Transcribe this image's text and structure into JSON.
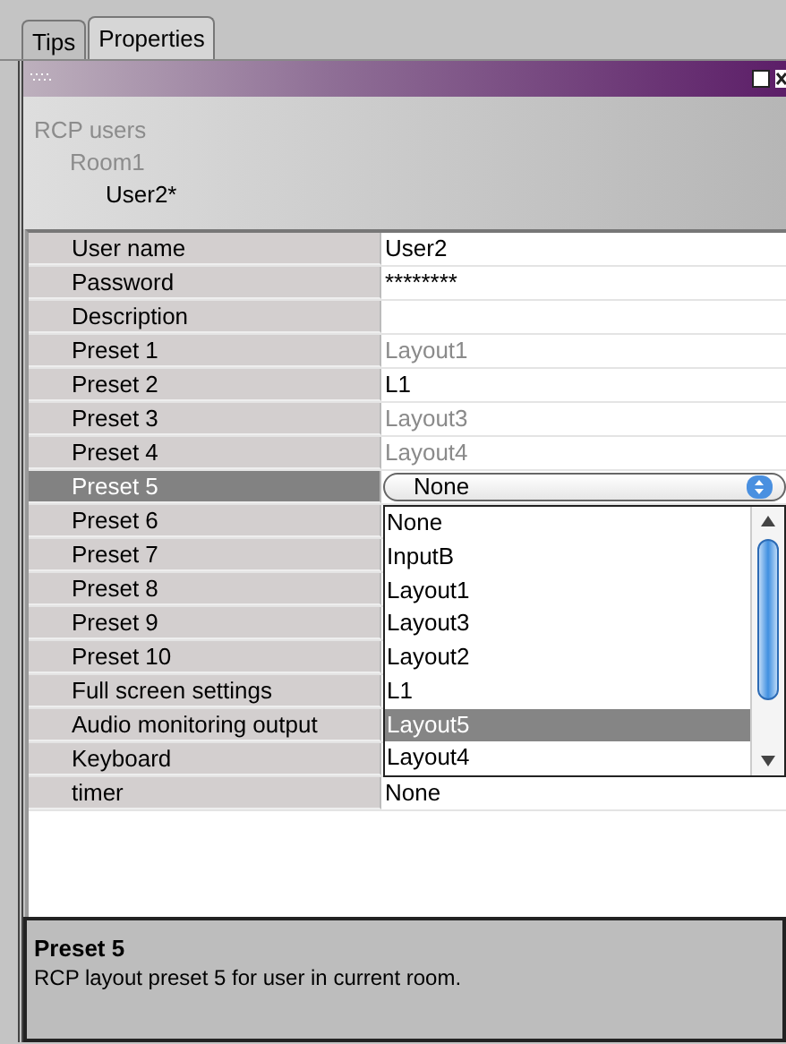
{
  "tabs": [
    {
      "label": "Tips",
      "selected": false
    },
    {
      "label": "Properties",
      "selected": true
    }
  ],
  "tree": [
    {
      "label": "RCP users",
      "dimmed": true,
      "children": [
        {
          "label": "Room1",
          "dimmed": true,
          "children": [
            {
              "label": "User2*",
              "dimmed": false
            }
          ]
        }
      ]
    }
  ],
  "properties": [
    {
      "name": "User name",
      "value": "User2",
      "kind": "text",
      "dimmed": false,
      "selected": false
    },
    {
      "name": "Password",
      "value": "********",
      "kind": "text",
      "dimmed": false,
      "selected": false
    },
    {
      "name": "Description",
      "kind": "text",
      "selected": false
    },
    {
      "name": "Preset 1",
      "value": "Layout1",
      "kind": "text",
      "dimmed": true,
      "selected": false
    },
    {
      "name": "Preset 2",
      "value": "L1",
      "kind": "text",
      "dimmed": false,
      "selected": false
    },
    {
      "name": "Preset 3",
      "value": "Layout3",
      "kind": "text",
      "dimmed": true,
      "selected": false
    },
    {
      "name": "Preset 4",
      "value": "Layout4",
      "kind": "text",
      "dimmed": true,
      "selected": false
    },
    {
      "name": "Preset 5",
      "value": "None",
      "kind": "combo",
      "selected": true
    },
    {
      "name": "Preset 6",
      "kind": "text",
      "selected": false
    },
    {
      "name": "Preset 7",
      "kind": "text",
      "selected": false
    },
    {
      "name": "Preset 8",
      "kind": "text",
      "selected": false
    },
    {
      "name": "Preset 9",
      "kind": "text",
      "selected": false
    },
    {
      "name": "Preset 10",
      "kind": "text",
      "selected": false
    },
    {
      "name": "Full screen settings",
      "kind": "text",
      "selected": false
    },
    {
      "name": "Audio monitoring output",
      "kind": "text",
      "selected": false
    },
    {
      "name": "Keyboard",
      "kind": "text",
      "selected": false
    },
    {
      "name": "timer",
      "value": "None",
      "kind": "text",
      "dimmed": false,
      "selected": false
    }
  ],
  "dropdown": {
    "items": [
      {
        "label": "None",
        "selected": false
      },
      {
        "label": "InputB",
        "selected": false
      },
      {
        "label": "Layout1",
        "selected": false
      },
      {
        "label": "Layout3",
        "selected": false
      },
      {
        "label": "Layout2",
        "selected": false
      },
      {
        "label": "L1",
        "selected": false
      },
      {
        "label": "Layout5",
        "selected": true
      },
      {
        "label": "Layout4",
        "selected": false
      }
    ]
  },
  "help": {
    "title": "Preset 5",
    "text": "RCP layout preset 5 for user in current room."
  }
}
